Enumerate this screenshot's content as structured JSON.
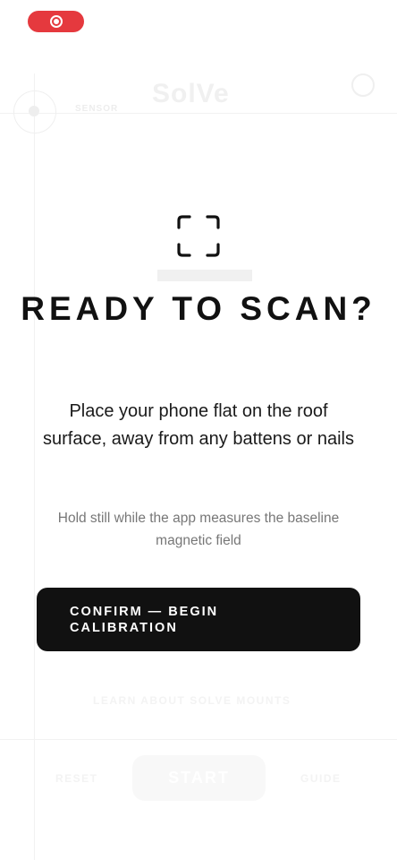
{
  "status_bar": {
    "record_icon": "record-icon",
    "record_color": "#e5393e"
  },
  "background_app": {
    "logo": "SolVe",
    "sensor_label": "SENSOR",
    "learn_link": "LEARN ABOUT SOLVE MOUNTS",
    "reset_label": "RESET",
    "start_label": "START",
    "guide_label": "GUIDE"
  },
  "modal": {
    "icon": "scan-frame-icon",
    "title": "READY TO SCAN?",
    "description": "Place your phone flat on the roof surface, away from any battens or nails",
    "hint": "Hold still while the app measures the baseline magnetic field",
    "confirm_label": "CONFIRM — BEGIN CALIBRATION"
  },
  "colors": {
    "primary_button": "#111111",
    "text": "#111111",
    "hint": "#777777"
  }
}
